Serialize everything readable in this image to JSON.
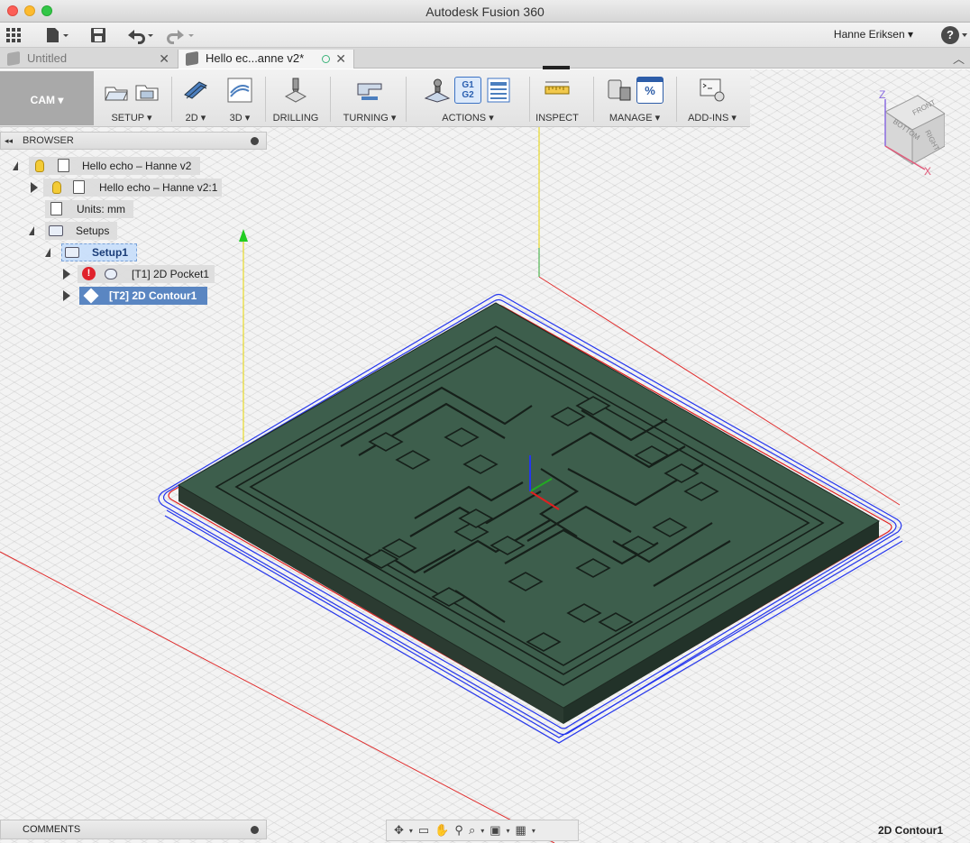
{
  "window": {
    "title": "Autodesk Fusion 360"
  },
  "appbar": {
    "user": "Hanne Eriksen ▾",
    "help": "?",
    "icons": [
      "grid-icon",
      "file-menu-icon",
      "save-icon",
      "undo-icon",
      "redo-icon"
    ]
  },
  "tabs": [
    {
      "label": "Untitled",
      "active": false
    },
    {
      "label": "Hello ec...anne v2*",
      "active": true
    }
  ],
  "toolbar": {
    "workspace": "CAM ▾",
    "groups": [
      {
        "label": "SETUP ▾"
      },
      {
        "label": "2D ▾"
      },
      {
        "label": "3D ▾"
      },
      {
        "label": "DRILLING"
      },
      {
        "label": "TURNING ▾"
      },
      {
        "label": "ACTIONS ▾"
      },
      {
        "label": "INSPECT"
      },
      {
        "label": "MANAGE ▾"
      },
      {
        "label": "ADD-INS ▾"
      }
    ],
    "g1g2_top": "G1",
    "g1g2_bottom": "G2",
    "percent": "%"
  },
  "browser": {
    "title": "BROWSER",
    "collapse": "◂◂",
    "items": [
      {
        "label": "Hello echo – Hanne v2"
      },
      {
        "label": "Hello echo – Hanne v2:1"
      },
      {
        "label": "Units: mm"
      },
      {
        "label": "Setups"
      },
      {
        "label": "Setup1"
      },
      {
        "label": "[T1] 2D Pocket1"
      },
      {
        "label": "[T2] 2D Contour1"
      }
    ],
    "error_mark": "!"
  },
  "comments": {
    "title": "COMMENTS"
  },
  "status": {
    "selection": "2D Contour1"
  },
  "viewcube": {
    "front": "FRONT",
    "right": "RIGHT",
    "bottom": "BOTTOM",
    "z": "Z",
    "x": "X"
  },
  "colors": {
    "board_top": "#3d5e4c",
    "board_side": "#2b3b31",
    "toolpath_blue": "#2536ee",
    "toolpath_red": "#e02020",
    "selection": "#5a86c2"
  }
}
